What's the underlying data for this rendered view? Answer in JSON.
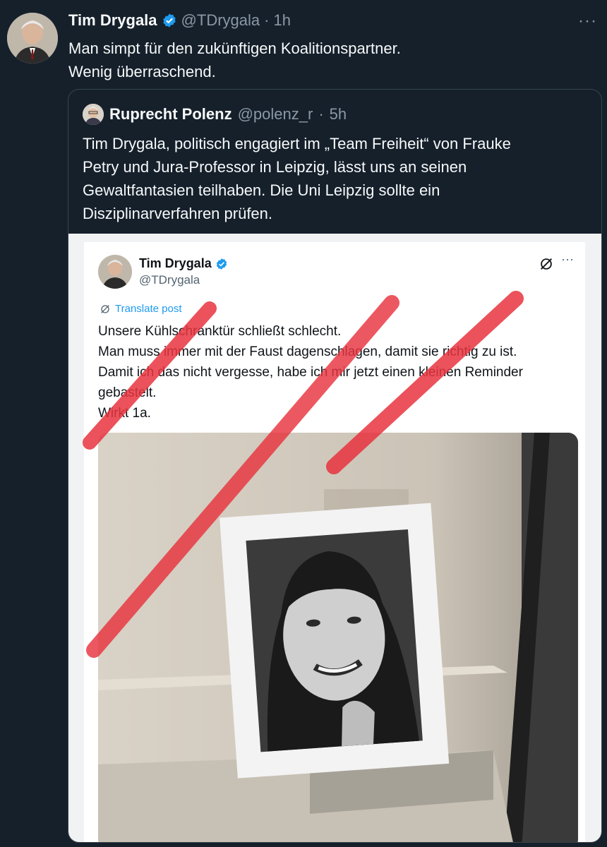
{
  "tweet": {
    "author_name": "Tim Drygala",
    "handle": "@TDrygala",
    "separator": "·",
    "time": "1h",
    "more_label": "···",
    "text_lines": [
      "Man simpt für den zukünftigen Koalitionspartner.",
      "Wenig überraschend."
    ]
  },
  "quote": {
    "author_name": "Ruprecht Polenz",
    "handle": "@polenz_r",
    "separator": "·",
    "time": "5h",
    "text_lines": [
      "Tim Drygala, politisch engagiert im „Team Freiheit“ von Frauke",
      "Petry und Jura-Professor in Leipzig, lässt uns an seinen",
      "Gewaltfantasien teilhaben. Die Uni Leipzig sollte ein",
      "Disziplinarverfahren prüfen."
    ]
  },
  "screenshot_post": {
    "author_name": "Tim Drygala",
    "handle": "@TDrygala",
    "translate_label": "Translate post",
    "more_label": "···",
    "text_lines": [
      "Unsere Kühlschranktür schließt schlecht.",
      "Man muss immer mit der Faust dagenschlagen, damit sie richtig zu ist.",
      "Damit ich das nicht vergesse, habe ich mir jetzt einen kleinen Reminder",
      "gebastelt.",
      "Wirkt 1a."
    ]
  },
  "colors": {
    "background": "#15202b",
    "verified": "#1d9bf0",
    "strike_marks": "#e8343f"
  },
  "icons": [
    "verified-badge-icon",
    "more-icon",
    "grok-icon",
    "translate-icon"
  ]
}
